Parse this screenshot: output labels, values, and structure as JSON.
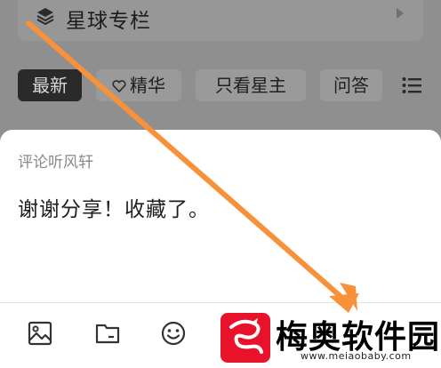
{
  "column": {
    "title": "星球专栏",
    "icon": "layers-icon"
  },
  "tabs": [
    {
      "label": "最新",
      "active": true
    },
    {
      "label": "精华",
      "icon": "heart-icon"
    },
    {
      "label": "只看星主"
    },
    {
      "label": "问答"
    }
  ],
  "comment_sheet": {
    "reply_label": "评论听风轩",
    "text": "谢谢分享！收藏了。",
    "toolbar_icons": [
      "image-icon",
      "folder-icon",
      "emoji-icon"
    ]
  },
  "watermark": {
    "brand_name": "梅奥软件园",
    "url": "www.meiaobaby.com"
  },
  "colors": {
    "annotation_arrow": "#f7913a",
    "watermark_logo": "#e8132a",
    "active_tab_bg": "#2a2a2a"
  }
}
